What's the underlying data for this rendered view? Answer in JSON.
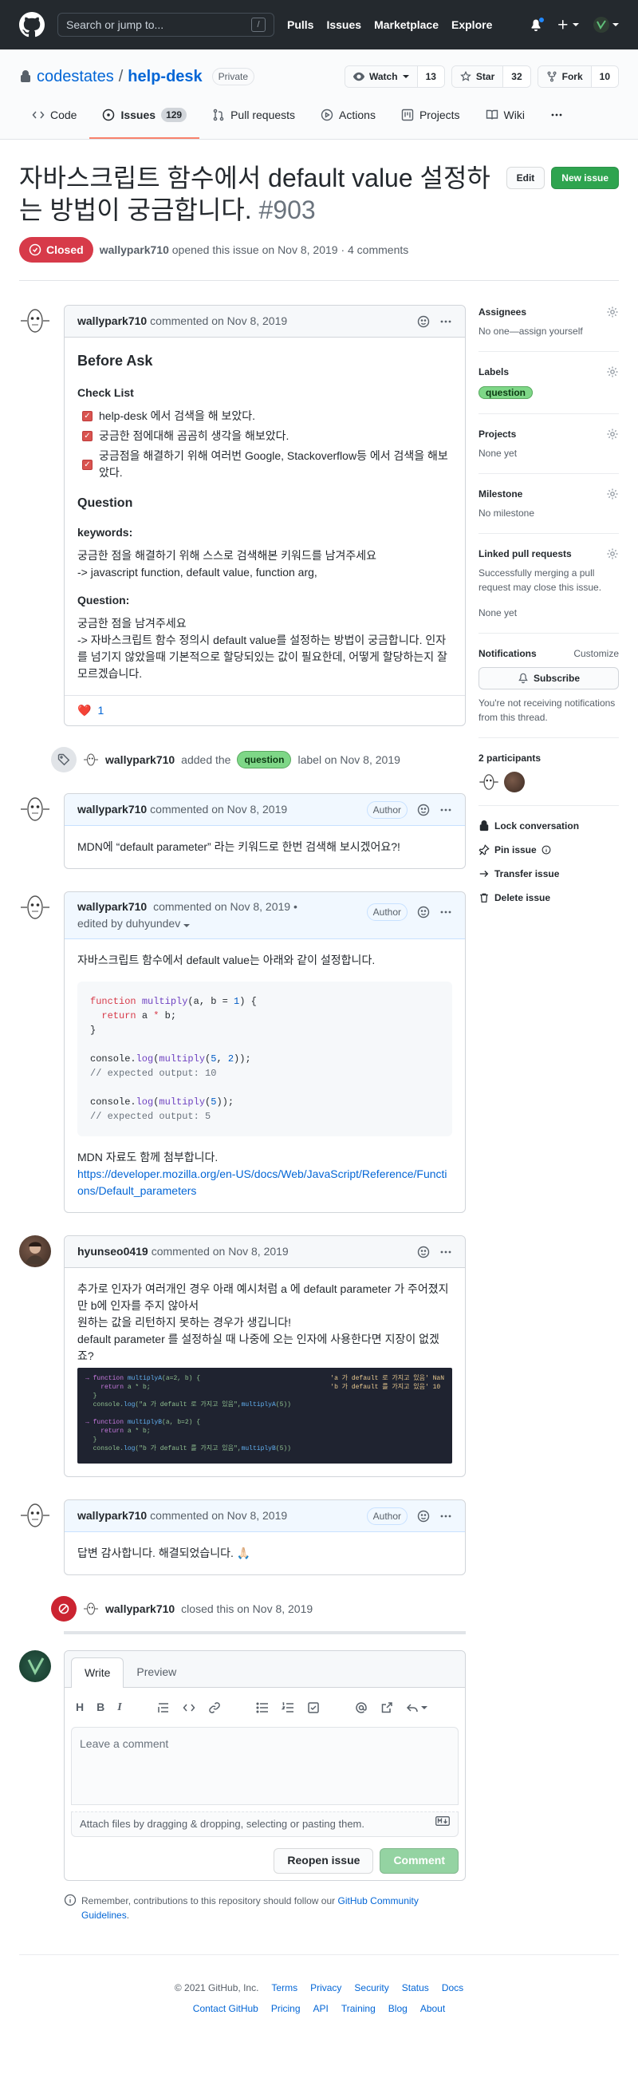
{
  "header": {
    "search_placeholder": "Search or jump to...",
    "search_key": "/",
    "nav": [
      "Pulls",
      "Issues",
      "Marketplace",
      "Explore"
    ]
  },
  "repo": {
    "owner": "codestates",
    "separator": "/",
    "name": "help-desk",
    "visibility": "Private",
    "watch_label": "Watch",
    "watch_count": "13",
    "star_label": "Star",
    "star_count": "32",
    "fork_label": "Fork",
    "fork_count": "10",
    "tabs": [
      {
        "label": "Code"
      },
      {
        "label": "Issues",
        "count": "129"
      },
      {
        "label": "Pull requests"
      },
      {
        "label": "Actions"
      },
      {
        "label": "Projects"
      },
      {
        "label": "Wiki"
      }
    ]
  },
  "issue": {
    "title": "자바스크립트 함수에서 default value 설정하는 방법이 궁금합니다.",
    "number": "#903",
    "edit_label": "Edit",
    "new_issue_label": "New issue",
    "state": "Closed",
    "author": "wallypark710",
    "meta": "opened this issue on Nov 8, 2019 · 4 comments"
  },
  "comments": {
    "c1": {
      "author": "wallypark710",
      "when": "commented on Nov 8, 2019",
      "h_before": "Before Ask",
      "h_checklist": "Check List",
      "tasks": [
        "help-desk 에서 검색을 해 보았다.",
        "궁금한 점에대해 곰곰히 생각을 해보았다.",
        "궁금점을 해결하기 위해 여러번 Google, Stackoverflow등 에서 검색을 해보았다."
      ],
      "h_question": "Question",
      "h_keywords": "keywords:",
      "kw_line1": "궁금한 점을 해결하기 위해 스스로 검색해본 키워드를 남겨주세요",
      "kw_line2": "-> javascript function, default value, function arg,",
      "h_q": "Question:",
      "q_line1": "궁금한 점을 남겨주세요",
      "q_line2": "-> 자바스크립트 함수 정의시 default value를 설정하는 방법이 궁금합니다. 인자를 넘기지 않았을때 기본적으로 할당되있는 값이 필요한데, 어떻게 할당하는지 잘 모르겠습니다.",
      "reaction_emoji": "❤️",
      "reaction_count": "1"
    },
    "event_label": {
      "author": "wallypark710",
      "pre": "added the",
      "label": "question",
      "post": "label on Nov 8, 2019"
    },
    "c2": {
      "author": "wallypark710",
      "when": "commented on Nov 8, 2019",
      "badge": "Author",
      "body": "MDN에 “default parameter” 라는 키워드로 한번 검색해 보시겠어요?!"
    },
    "c3": {
      "author": "wallypark710",
      "when": "commented on Nov 8, 2019 •",
      "edited": "edited by duhyundev",
      "badge": "Author",
      "intro": "자바스크립트 함수에서 default value는 아래와 같이 설정합니다.",
      "mdn_text": "MDN 자료도 함께 첨부합니다.",
      "mdn_link": "https://developer.mozilla.org/en-US/docs/Web/JavaScript/Reference/Functions/Default_parameters"
    },
    "c4": {
      "author": "hyunseo0419",
      "when": "commented on Nov 8, 2019",
      "line1": "추가로 인자가 여러개인 경우 아래 예시처럼 a 에 default parameter 가 주어졌지만 b에 인자를 주지 않아서",
      "line2": "원하는 값을 리턴하지 못하는 경우가 생깁니다!",
      "line3": "default parameter 를 설정하실 때 나중에 오는 인자에 사용한다면 지장이 없겠죠?",
      "img_right1": "'a 가 default 로 가지고 있음' NaN",
      "img_right2": "'b 가 default 를 가지고 있음' 10"
    },
    "c5": {
      "author": "wallypark710",
      "when": "commented on Nov 8, 2019",
      "badge": "Author",
      "body": "답변 감사합니다. 해결되었습니다. 🙏🏻"
    },
    "event_closed": {
      "author": "wallypark710",
      "text": "closed this on Nov 8, 2019"
    }
  },
  "editor": {
    "tab_write": "Write",
    "tab_preview": "Preview",
    "placeholder": "Leave a comment",
    "attach": "Attach files by dragging & dropping, selecting or pasting them.",
    "reopen": "Reopen issue",
    "comment": "Comment",
    "remember_pre": "Remember, contributions to this repository should follow our",
    "remember_link": "GitHub Community Guidelines",
    "remember_post": "."
  },
  "sidebar": {
    "assignees_title": "Assignees",
    "assignees_val": "No one—assign yourself",
    "labels_title": "Labels",
    "labels_val": "question",
    "projects_title": "Projects",
    "projects_val": "None yet",
    "milestone_title": "Milestone",
    "milestone_val": "No milestone",
    "linked_title": "Linked pull requests",
    "linked_desc": "Successfully merging a pull request may close this issue.",
    "linked_val": "None yet",
    "notif_title": "Notifications",
    "notif_customize": "Customize",
    "subscribe": "Subscribe",
    "notif_desc": "You're not receiving notifications from this thread.",
    "participants_title": "2 participants",
    "lock": "Lock conversation",
    "pin": "Pin issue",
    "transfer": "Transfer issue",
    "delete": "Delete issue"
  },
  "footer": {
    "copyright": "© 2021 GitHub, Inc.",
    "row1": [
      "Terms",
      "Privacy",
      "Security",
      "Status",
      "Docs"
    ],
    "row2": [
      "Contact GitHub",
      "Pricing",
      "API",
      "Training",
      "Blog",
      "About"
    ]
  },
  "colors": {
    "header_bg": "#24292e",
    "closed": "#d73a49",
    "new_issue": "#2ea44f",
    "label_question": "#7ed787",
    "link": "#0366d6"
  }
}
